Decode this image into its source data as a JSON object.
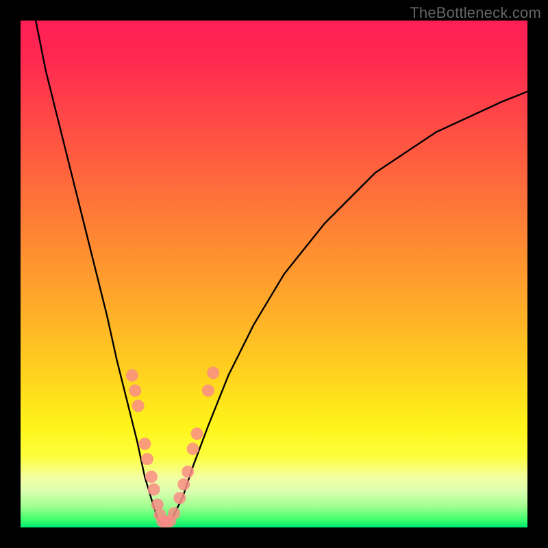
{
  "watermark": "TheBottleneck.com",
  "chart_data": {
    "type": "line",
    "title": "",
    "xlabel": "",
    "ylabel": "",
    "xlim": [
      0,
      100
    ],
    "ylim": [
      0,
      100
    ],
    "series": [
      {
        "name": "bottleneck-curve",
        "x": [
          3,
          5,
          8,
          11,
          14,
          17,
          19,
          21,
          23,
          24.5,
          26,
          27,
          27.8,
          28.5,
          30,
          32,
          34,
          37,
          41,
          46,
          52,
          60,
          70,
          82,
          95,
          100
        ],
        "y": [
          100,
          90,
          78,
          66,
          54,
          42,
          33,
          25,
          17,
          10,
          5,
          2,
          0.5,
          0.5,
          2,
          6,
          12,
          20,
          30,
          40,
          50,
          60,
          70,
          78,
          84,
          86
        ]
      }
    ],
    "markers": {
      "name": "highlighted-points",
      "color": "#f98d86",
      "points": [
        {
          "x": 22.0,
          "y": 30.0
        },
        {
          "x": 22.6,
          "y": 27.0
        },
        {
          "x": 23.2,
          "y": 24.0
        },
        {
          "x": 24.5,
          "y": 16.5
        },
        {
          "x": 25.0,
          "y": 13.5
        },
        {
          "x": 25.8,
          "y": 10.0
        },
        {
          "x": 26.3,
          "y": 7.5
        },
        {
          "x": 27.0,
          "y": 4.5
        },
        {
          "x": 27.5,
          "y": 2.5
        },
        {
          "x": 28.0,
          "y": 1.2
        },
        {
          "x": 28.7,
          "y": 1.0
        },
        {
          "x": 29.5,
          "y": 1.3
        },
        {
          "x": 30.3,
          "y": 2.8
        },
        {
          "x": 31.4,
          "y": 5.8
        },
        {
          "x": 32.2,
          "y": 8.5
        },
        {
          "x": 33.0,
          "y": 11.0
        },
        {
          "x": 34.0,
          "y": 15.5
        },
        {
          "x": 34.8,
          "y": 18.5
        },
        {
          "x": 37.0,
          "y": 27.0
        },
        {
          "x": 38.0,
          "y": 30.5
        }
      ]
    }
  }
}
